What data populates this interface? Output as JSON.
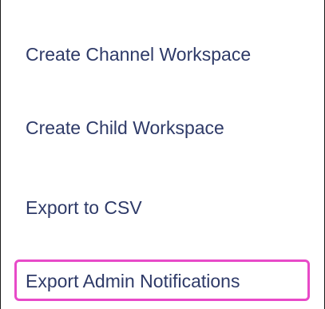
{
  "menu": {
    "items": [
      {
        "label": "Create Channel Workspace"
      },
      {
        "label": "Create Child Workspace"
      },
      {
        "label": "Export to CSV"
      },
      {
        "label": "Export Admin Notifications"
      }
    ],
    "highlighted_item_index": 3,
    "colors": {
      "text": "#2e3a68",
      "highlight_border": "#e84ac8",
      "frame_border": "#1a1a1a",
      "background": "#ffffff"
    }
  }
}
